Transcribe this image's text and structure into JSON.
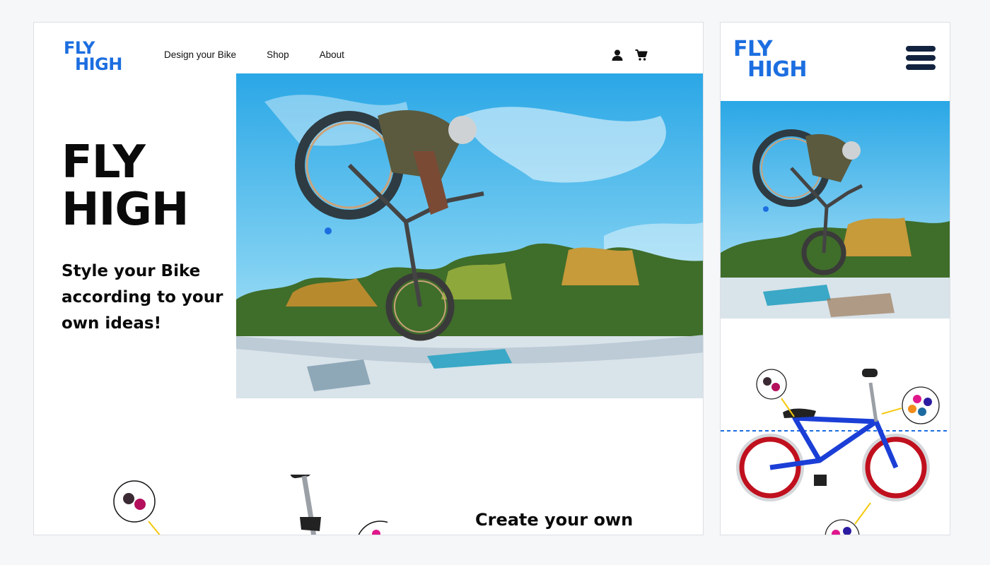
{
  "desktop": {
    "logo": {
      "line1": "FLY",
      "line2": "HIGH"
    },
    "nav": [
      "Design your Bike",
      "Shop",
      "About"
    ],
    "icons": [
      "user-icon",
      "cart-icon"
    ],
    "hero": {
      "title_line1": "FLY",
      "title_line2": "HIGH",
      "subtitle": "Style your Bike according to your own ideas!"
    },
    "section_heading": "Create your own"
  },
  "mobile": {
    "logo": {
      "line1": "FLY",
      "line2": "HIGH"
    },
    "menu_icon": "hamburger-menu-icon"
  },
  "colors": {
    "brand_blue": "#1c6ee0",
    "text_dark": "#0a0a0a",
    "menu_navy": "#13233f",
    "bike_frame": "#1b3fd6",
    "rim_red": "#c0101e"
  }
}
